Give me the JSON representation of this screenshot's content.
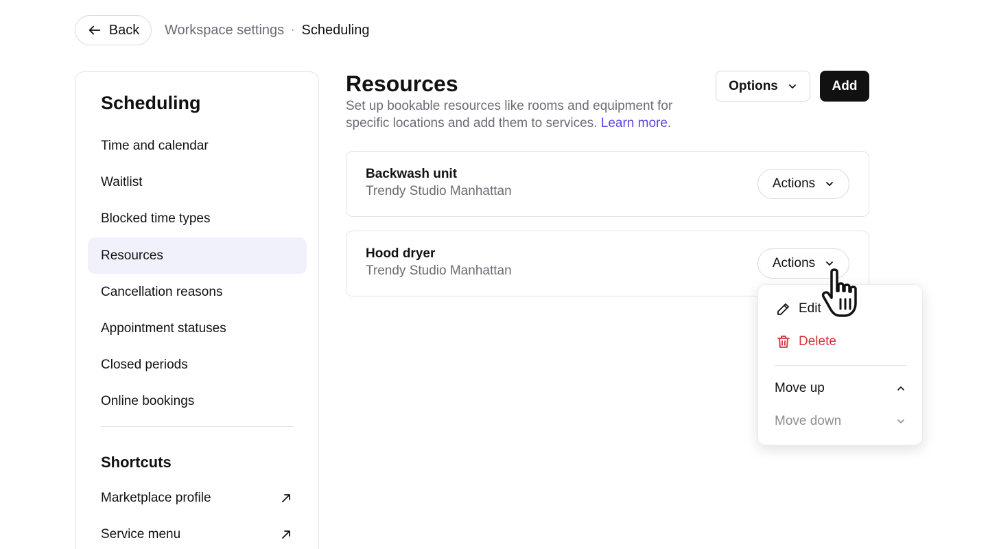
{
  "header": {
    "back_label": "Back",
    "breadcrumb": {
      "parent": "Workspace settings",
      "separator": "·",
      "current": "Scheduling"
    }
  },
  "sidebar": {
    "title": "Scheduling",
    "items": [
      {
        "label": "Time and calendar",
        "active": false
      },
      {
        "label": "Waitlist",
        "active": false
      },
      {
        "label": "Blocked time types",
        "active": false
      },
      {
        "label": "Resources",
        "active": true
      },
      {
        "label": "Cancellation reasons",
        "active": false
      },
      {
        "label": "Appointment statuses",
        "active": false
      },
      {
        "label": "Closed periods",
        "active": false
      },
      {
        "label": "Online bookings",
        "active": false
      }
    ],
    "shortcuts_title": "Shortcuts",
    "shortcuts": [
      {
        "label": "Marketplace profile",
        "icon": "external-link-icon"
      },
      {
        "label": "Service menu",
        "icon": "external-link-icon"
      }
    ]
  },
  "main": {
    "title": "Resources",
    "description": "Set up bookable resources like rooms and equipment for specific locations and add them to services.",
    "learn_more": "Learn more",
    "learn_more_suffix": ".",
    "options_label": "Options",
    "add_label": "Add",
    "resources": [
      {
        "name": "Backwash unit",
        "location": "Trendy Studio Manhattan",
        "actions_label": "Actions"
      },
      {
        "name": "Hood dryer",
        "location": "Trendy Studio Manhattan",
        "actions_label": "Actions"
      }
    ]
  },
  "actions_menu": {
    "edit": "Edit",
    "delete": "Delete",
    "move_up": "Move up",
    "move_down": "Move down"
  },
  "colors": {
    "accent_link": "#5b47e0",
    "danger": "#d6303a",
    "active_nav_bg": "#f1f1fb",
    "primary_button": "#111111"
  }
}
